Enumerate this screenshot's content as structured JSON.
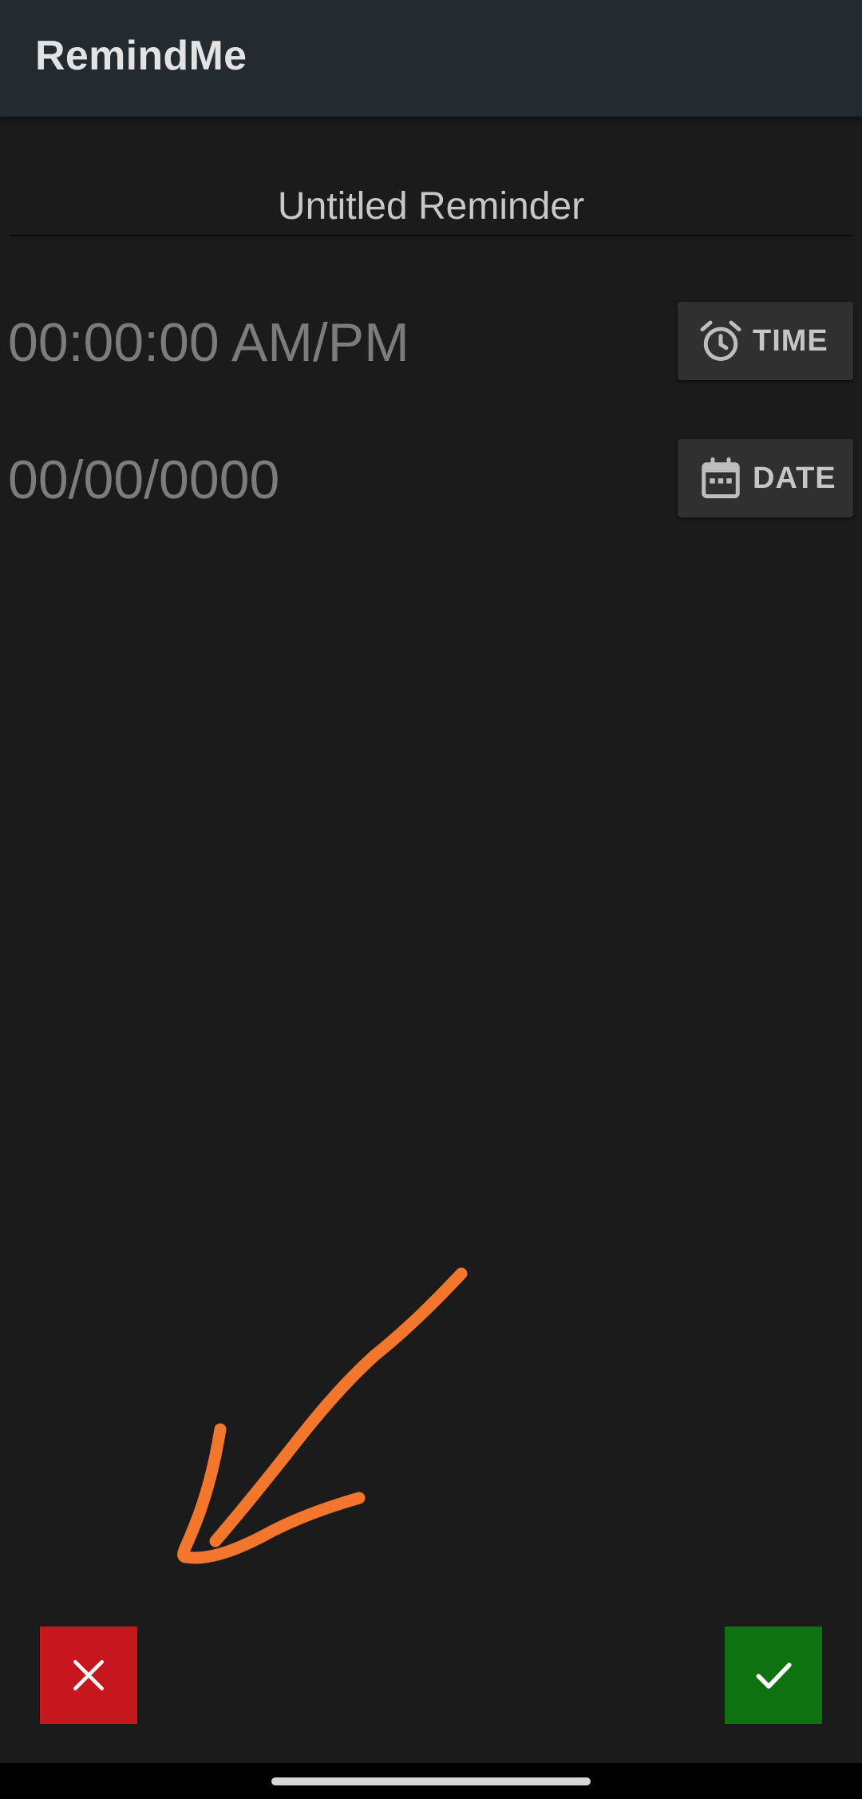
{
  "app_bar": {
    "title": "RemindMe"
  },
  "reminder": {
    "title_placeholder": "Untitled Reminder",
    "time_value": "00:00:00 AM/PM",
    "date_value": "00/00/0000"
  },
  "buttons": {
    "time_label": "TIME",
    "time_icon": "alarm-clock-icon",
    "date_label": "DATE",
    "date_icon": "calendar-icon",
    "cancel_icon": "close-icon",
    "confirm_icon": "check-icon"
  },
  "colors": {
    "app_bar": "#232a30",
    "background": "#1b1b1b",
    "cancel": "#c5171d",
    "confirm": "#0f7210",
    "annotation_arrow": "#f2762c"
  }
}
